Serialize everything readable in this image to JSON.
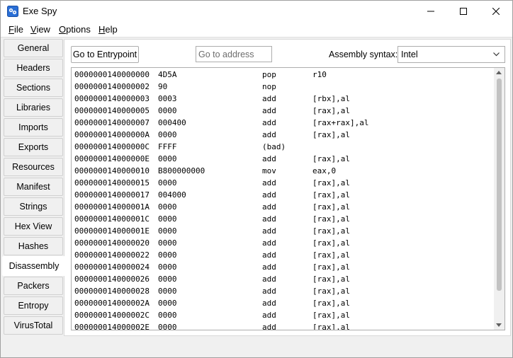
{
  "window": {
    "title": "Exe Spy",
    "icon": "app-icon"
  },
  "menu": {
    "file": {
      "underline": "F",
      "rest": "ile"
    },
    "view": {
      "underline": "V",
      "rest": "iew"
    },
    "options": {
      "underline": "O",
      "rest": "ptions"
    },
    "help": {
      "underline": "H",
      "rest": "elp"
    }
  },
  "tabs": [
    {
      "label": "General"
    },
    {
      "label": "Headers"
    },
    {
      "label": "Sections"
    },
    {
      "label": "Libraries"
    },
    {
      "label": "Imports"
    },
    {
      "label": "Exports"
    },
    {
      "label": "Resources"
    },
    {
      "label": "Manifest"
    },
    {
      "label": "Strings"
    },
    {
      "label": "Hex View"
    },
    {
      "label": "Hashes"
    },
    {
      "label": "Disassembly",
      "active": true
    },
    {
      "label": "Packers"
    },
    {
      "label": "Entropy"
    },
    {
      "label": "VirusTotal"
    }
  ],
  "toolbar": {
    "entry_label": "Go to Entrypoint",
    "goto_placeholder": "Go to address",
    "syntax_label": "Assembly syntax:",
    "syntax_value": "Intel"
  },
  "listing": {
    "rows": [
      {
        "addr": "0000000140000000",
        "bytes": "4D5A",
        "mnem": "pop",
        "ops": "r10"
      },
      {
        "addr": "0000000140000002",
        "bytes": "90",
        "mnem": "nop",
        "ops": ""
      },
      {
        "addr": "0000000140000003",
        "bytes": "0003",
        "mnem": "add",
        "ops": "[rbx],al"
      },
      {
        "addr": "0000000140000005",
        "bytes": "0000",
        "mnem": "add",
        "ops": "[rax],al"
      },
      {
        "addr": "0000000140000007",
        "bytes": "000400",
        "mnem": "add",
        "ops": "[rax+rax],al"
      },
      {
        "addr": "000000014000000A",
        "bytes": "0000",
        "mnem": "add",
        "ops": "[rax],al"
      },
      {
        "addr": "000000014000000C",
        "bytes": "FFFF",
        "mnem": "(bad)",
        "ops": ""
      },
      {
        "addr": "000000014000000E",
        "bytes": "0000",
        "mnem": "add",
        "ops": "[rax],al"
      },
      {
        "addr": "0000000140000010",
        "bytes": "B800000000",
        "mnem": "mov",
        "ops": "eax,0"
      },
      {
        "addr": "0000000140000015",
        "bytes": "0000",
        "mnem": "add",
        "ops": "[rax],al"
      },
      {
        "addr": "0000000140000017",
        "bytes": "004000",
        "mnem": "add",
        "ops": "[rax],al"
      },
      {
        "addr": "000000014000001A",
        "bytes": "0000",
        "mnem": "add",
        "ops": "[rax],al"
      },
      {
        "addr": "000000014000001C",
        "bytes": "0000",
        "mnem": "add",
        "ops": "[rax],al"
      },
      {
        "addr": "000000014000001E",
        "bytes": "0000",
        "mnem": "add",
        "ops": "[rax],al"
      },
      {
        "addr": "0000000140000020",
        "bytes": "0000",
        "mnem": "add",
        "ops": "[rax],al"
      },
      {
        "addr": "0000000140000022",
        "bytes": "0000",
        "mnem": "add",
        "ops": "[rax],al"
      },
      {
        "addr": "0000000140000024",
        "bytes": "0000",
        "mnem": "add",
        "ops": "[rax],al"
      },
      {
        "addr": "0000000140000026",
        "bytes": "0000",
        "mnem": "add",
        "ops": "[rax],al"
      },
      {
        "addr": "0000000140000028",
        "bytes": "0000",
        "mnem": "add",
        "ops": "[rax],al"
      },
      {
        "addr": "000000014000002A",
        "bytes": "0000",
        "mnem": "add",
        "ops": "[rax],al"
      },
      {
        "addr": "000000014000002C",
        "bytes": "0000",
        "mnem": "add",
        "ops": "[rax],al"
      },
      {
        "addr": "000000014000002E",
        "bytes": "0000",
        "mnem": "add",
        "ops": "[rax],al"
      }
    ]
  },
  "colors": {
    "accent": "#0078d7",
    "icon_blue": "#2a6fd6"
  }
}
